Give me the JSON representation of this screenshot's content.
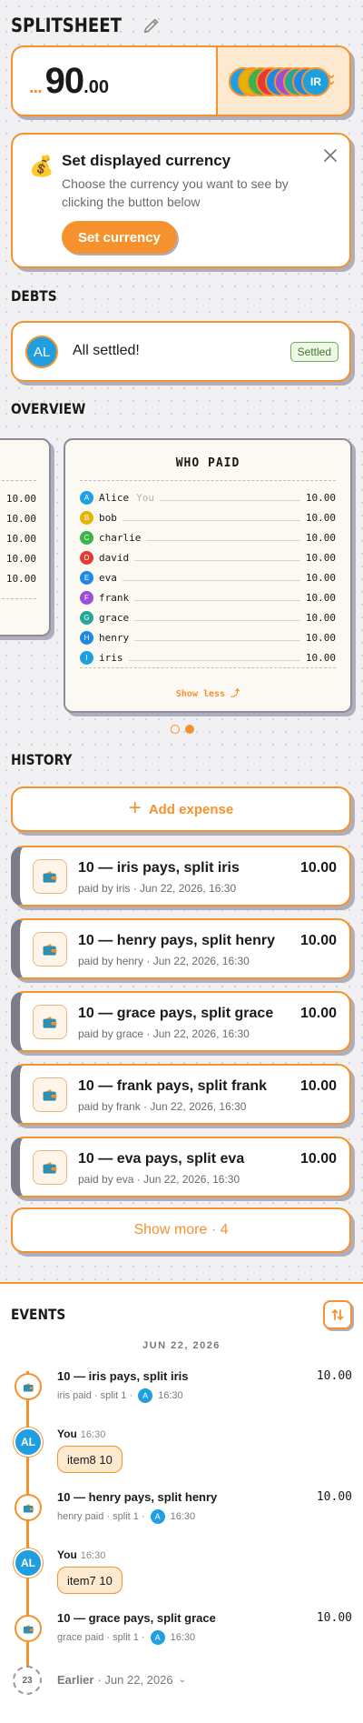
{
  "app": {
    "title": "SPLITSHEET",
    "edit_icon": "pencil-icon"
  },
  "total": {
    "prefix": "...",
    "integer": "90",
    "decimal": ".00"
  },
  "participants_stack": {
    "label": "IR",
    "avatars": [
      {
        "initial": "A",
        "color": "#1f9fe0"
      },
      {
        "initial": "B",
        "color": "#e5b400"
      },
      {
        "initial": "C",
        "color": "#38b44a"
      },
      {
        "initial": "D",
        "color": "#e53935"
      },
      {
        "initial": "E",
        "color": "#1e88e5"
      },
      {
        "initial": "F",
        "color": "#9c4fd6"
      },
      {
        "initial": "G",
        "color": "#26a69a"
      },
      {
        "initial": "H",
        "color": "#1e88e5"
      },
      {
        "initial": "IR",
        "color": "#1f9fe0"
      }
    ]
  },
  "currency_notice": {
    "title": "Set displayed currency",
    "description": "Choose the currency you want to see by clicking the button below",
    "button": "Set currency",
    "icon": "money-bag-icon"
  },
  "debts": {
    "section_title": "DEBTS",
    "avatar": "AL",
    "message": "All settled!",
    "badge": "Settled"
  },
  "overview": {
    "section_title": "OVERVIEW",
    "back_values": [
      "10.00",
      "10.00",
      "10.00",
      "10.00",
      "10.00"
    ],
    "receipt": {
      "title": "WHO PAID",
      "show_less": "Show less ⤴",
      "payers": [
        {
          "initial": "A",
          "name": "Alice",
          "tag": "You",
          "amount": "10.00",
          "color": "#1f9fe0"
        },
        {
          "initial": "B",
          "name": "bob",
          "tag": "",
          "amount": "10.00",
          "color": "#e5b400"
        },
        {
          "initial": "C",
          "name": "charlie",
          "tag": "",
          "amount": "10.00",
          "color": "#38b44a"
        },
        {
          "initial": "D",
          "name": "david",
          "tag": "",
          "amount": "10.00",
          "color": "#e53935"
        },
        {
          "initial": "E",
          "name": "eva",
          "tag": "",
          "amount": "10.00",
          "color": "#1e88e5"
        },
        {
          "initial": "F",
          "name": "frank",
          "tag": "",
          "amount": "10.00",
          "color": "#9c4fd6"
        },
        {
          "initial": "G",
          "name": "grace",
          "tag": "",
          "amount": "10.00",
          "color": "#26a69a"
        },
        {
          "initial": "H",
          "name": "henry",
          "tag": "",
          "amount": "10.00",
          "color": "#1e88e5"
        },
        {
          "initial": "I",
          "name": "iris",
          "tag": "",
          "amount": "10.00",
          "color": "#1f9fe0"
        }
      ]
    },
    "pager": {
      "pages": 2,
      "active": 2
    }
  },
  "history": {
    "section_title": "HISTORY",
    "add_expense": "Add expense",
    "expenses": [
      {
        "title": "10 — iris pays, split iris",
        "sub": "paid by iris · Jun 22, 2026, 16:30",
        "amount": "10.00"
      },
      {
        "title": "10 — henry pays, split henry",
        "sub": "paid by henry · Jun 22, 2026, 16:30",
        "amount": "10.00"
      },
      {
        "title": "10 — grace pays, split grace",
        "sub": "paid by grace · Jun 22, 2026, 16:30",
        "amount": "10.00"
      },
      {
        "title": "10 — frank pays, split frank",
        "sub": "paid by frank · Jun 22, 2026, 16:30",
        "amount": "10.00"
      },
      {
        "title": "10 — eva pays, split eva",
        "sub": "paid by eva · Jun 22, 2026, 16:30",
        "amount": "10.00"
      }
    ],
    "show_more": "Show more · 4"
  },
  "events": {
    "section_title": "EVENTS",
    "date": "JUN 22, 2026",
    "items": [
      {
        "kind": "expense",
        "title": "10 — iris pays, split iris",
        "paid": "iris paid · split 1 ·",
        "avatar": "A",
        "time": "16:30",
        "amount": "10.00"
      },
      {
        "kind": "message",
        "who": "You",
        "avatar": "AL",
        "time": "16:30",
        "text": "item8 10"
      },
      {
        "kind": "expense",
        "title": "10 — henry pays, split henry",
        "paid": "henry paid · split 1 ·",
        "avatar": "A",
        "time": "16:30",
        "amount": "10.00"
      },
      {
        "kind": "message",
        "who": "You",
        "avatar": "AL",
        "time": "16:30",
        "text": "item7 10"
      },
      {
        "kind": "expense",
        "title": "10 — grace pays, split grace",
        "paid": "grace paid · split 1 ·",
        "avatar": "A",
        "time": "16:30",
        "amount": "10.00"
      }
    ],
    "earlier": {
      "count": "23",
      "label": "Earlier",
      "date": "· Jun 22, 2026"
    }
  },
  "colors": {
    "accent": "#f5922e",
    "avatar_blue": "#1f9fe0",
    "settled_green": "#6ab04c"
  }
}
